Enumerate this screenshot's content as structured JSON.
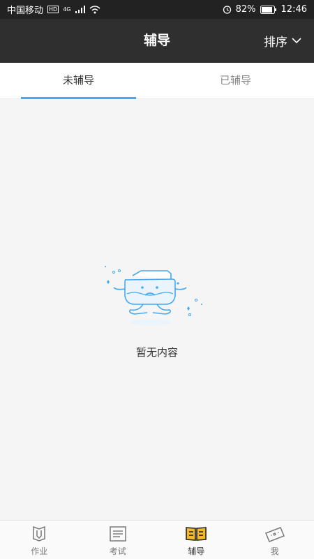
{
  "status_bar": {
    "carrier": "中国移动",
    "network": "4G",
    "battery": "82%",
    "time": "12:46"
  },
  "header": {
    "title": "辅导",
    "sort_label": "排序"
  },
  "tabs": [
    {
      "label": "未辅导",
      "active": true
    },
    {
      "label": "已辅导",
      "active": false
    }
  ],
  "empty_state": {
    "text": "暂无内容"
  },
  "bottom_nav": [
    {
      "label": "作业",
      "icon": "pencil-book-icon"
    },
    {
      "label": "考试",
      "icon": "document-icon"
    },
    {
      "label": "辅导",
      "icon": "open-book-icon",
      "active": true
    },
    {
      "label": "我",
      "icon": "ticket-icon"
    }
  ],
  "colors": {
    "accent": "#45a8f0",
    "active_icon": "#f2b92a",
    "header_bg": "#2f2f2f"
  }
}
